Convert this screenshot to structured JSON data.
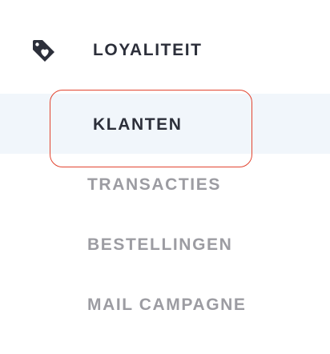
{
  "section": {
    "title": "LOYALITEIT",
    "icon": "tag-heart-icon"
  },
  "menu": {
    "items": [
      {
        "label": "KLANTEN",
        "active": true
      },
      {
        "label": "TRANSACTIES",
        "active": false
      },
      {
        "label": "BESTELLINGEN",
        "active": false
      },
      {
        "label": "MAIL CAMPAGNE",
        "active": false
      }
    ]
  },
  "colors": {
    "active_text": "#2c2f3a",
    "inactive_text": "#9c9ca2",
    "active_background": "#f1f6fb",
    "focus_ring": "#e2442f"
  }
}
